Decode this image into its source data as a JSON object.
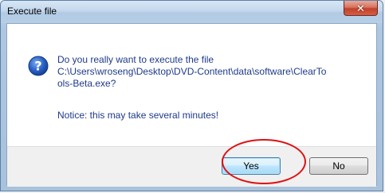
{
  "window": {
    "title": "Execute file"
  },
  "message": {
    "question": "Do you really want to execute the file",
    "path_line1": "C:\\Users\\wroseng\\Desktop\\DVD-Content\\data\\software\\ClearTo",
    "path_line2": "ols-Beta.exe?",
    "notice": "Notice: this may take several minutes!"
  },
  "buttons": {
    "yes_label": "Yes",
    "no_label": "No"
  },
  "icons": {
    "close": "close-icon",
    "question": "question-icon"
  },
  "colors": {
    "message_text": "#1e3a8a",
    "annotation": "#e01010",
    "close_button": "#c1412a"
  }
}
